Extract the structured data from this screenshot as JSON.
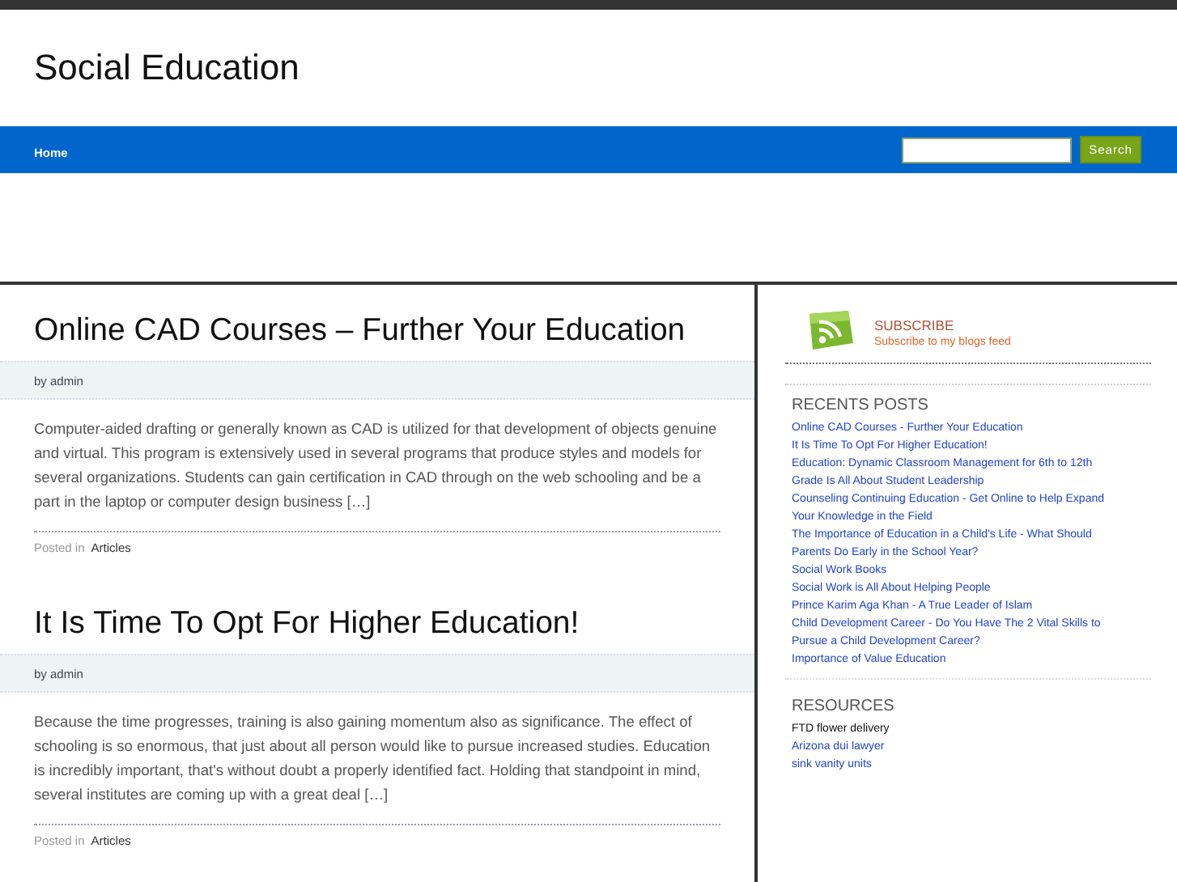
{
  "site_title": "Social Education",
  "nav": {
    "items": [
      {
        "label": "Home"
      }
    ],
    "search": {
      "button": "Search"
    }
  },
  "posts": [
    {
      "title": "Online CAD Courses – Further Your Education",
      "byline": "by admin",
      "excerpt": "Computer-aided drafting or generally known as CAD is utilized for that development of objects genuine and virtual. This program is extensively used in several programs that produce styles and models for several organizations. Students can gain certification in CAD through on the web schooling and be a part in the laptop or computer design business […]",
      "posted_label": "Posted in",
      "category": "Articles"
    },
    {
      "title": "It Is Time To Opt For Higher Education!",
      "byline": "by admin",
      "excerpt": "Because the time progresses, training is also gaining momentum also as significance. The effect of schooling is so enormous, that just about all person would like to pursue increased studies. Education is incredibly important, that's without doubt a properly identified fact. Holding that standpoint in mind, several institutes are coming up with a great deal […]",
      "posted_label": "Posted in",
      "category": "Articles"
    }
  ],
  "sidebar": {
    "subscribe": {
      "title": "SUBSCRIBE",
      "subtitle": "Subscribe to my blogs feed"
    },
    "recent_posts": {
      "heading": "RECENTS POSTS",
      "items": [
        "Online CAD Courses - Further Your Education",
        "It Is Time To Opt For Higher Education!",
        "Education: Dynamic Classroom Management for 6th to 12th Grade Is All About Student Leadership",
        "Counseling Continuing Education - Get Online to Help Expand Your Knowledge in the Field",
        "The Importance of Education in a Child's Life - What Should Parents Do Early in the School Year?",
        "Social Work Books",
        "Social Work is All About Helping People",
        "Prince Karim Aga Khan - A True Leader of Islam",
        "Child Development Career - Do You Have The 2 Vital Skills to Pursue a Child Development Career?",
        "Importance of Value Education"
      ]
    },
    "resources": {
      "heading": "RESOURCES",
      "items": [
        {
          "label": "FTD flower delivery",
          "kind": "text"
        },
        {
          "label": "Arizona dui lawyer",
          "kind": "link"
        },
        {
          "label": "sink vanity units",
          "kind": "link"
        }
      ]
    }
  }
}
